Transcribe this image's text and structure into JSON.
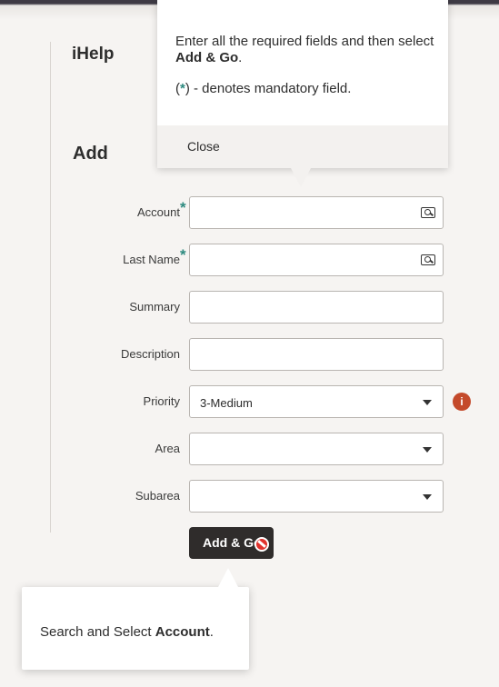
{
  "app": {
    "title": "iHelp"
  },
  "page": {
    "title": "Add"
  },
  "form": {
    "fields": [
      {
        "label": "Account",
        "required": true,
        "value": ""
      },
      {
        "label": "Last Name",
        "required": true,
        "value": ""
      },
      {
        "label": "Summary",
        "required": false,
        "value": ""
      },
      {
        "label": "Description",
        "required": false,
        "value": ""
      },
      {
        "label": "Priority",
        "required": false,
        "value": "3-Medium"
      },
      {
        "label": "Area",
        "required": false,
        "value": ""
      },
      {
        "label": "Subarea",
        "required": false,
        "value": ""
      }
    ],
    "required_marker": "*",
    "info_icon_glyph": "i",
    "submit_label": "Add & Go"
  },
  "tooltip_top": {
    "message_prefix": "Enter all the required fields and then select ",
    "message_bold": "Add & Go",
    "message_suffix": ".",
    "mandatory_open": "(",
    "mandatory_star": "*",
    "mandatory_rest": ") - denotes mandatory field.",
    "close_label": "Close"
  },
  "tooltip_bottom": {
    "message_prefix": "Search and Select ",
    "message_bold": "Account",
    "message_suffix": "."
  },
  "colors": {
    "accent_required": "#2d8a7f",
    "info_badge": "#c44a2b",
    "primary_button": "#2f2c2b",
    "blocked_icon": "#e0312b"
  }
}
